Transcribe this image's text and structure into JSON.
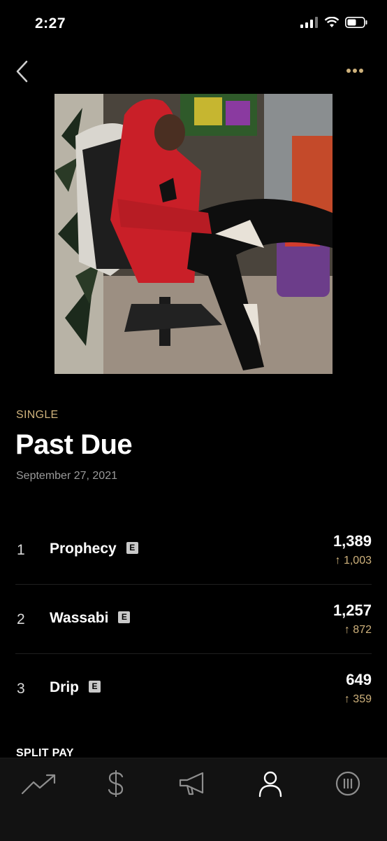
{
  "status_bar": {
    "time": "2:27"
  },
  "nav": {
    "back_icon": "chevron-left-icon",
    "more_icon": "ellipsis-icon",
    "accent": "#cfb27c"
  },
  "release": {
    "type_label": "SINGLE",
    "title": "Past Due",
    "date": "September 27, 2021"
  },
  "tracks": [
    {
      "number": "1",
      "name": "Prophecy",
      "explicit": "E",
      "plays": "1,389",
      "change": "↑ 1,003"
    },
    {
      "number": "2",
      "name": "Wassabi",
      "explicit": "E",
      "plays": "1,257",
      "change": "↑ 872"
    },
    {
      "number": "3",
      "name": "Drip",
      "explicit": "E",
      "plays": "649",
      "change": "↑ 359"
    }
  ],
  "sections": {
    "split_pay_title": "SPLIT PAY"
  },
  "tab_bar": {
    "items": [
      {
        "icon": "trend-icon",
        "active": false
      },
      {
        "icon": "dollar-icon",
        "active": false
      },
      {
        "icon": "megaphone-icon",
        "active": false
      },
      {
        "icon": "user-icon",
        "active": true
      },
      {
        "icon": "pause-circle-icon",
        "active": false
      }
    ]
  }
}
